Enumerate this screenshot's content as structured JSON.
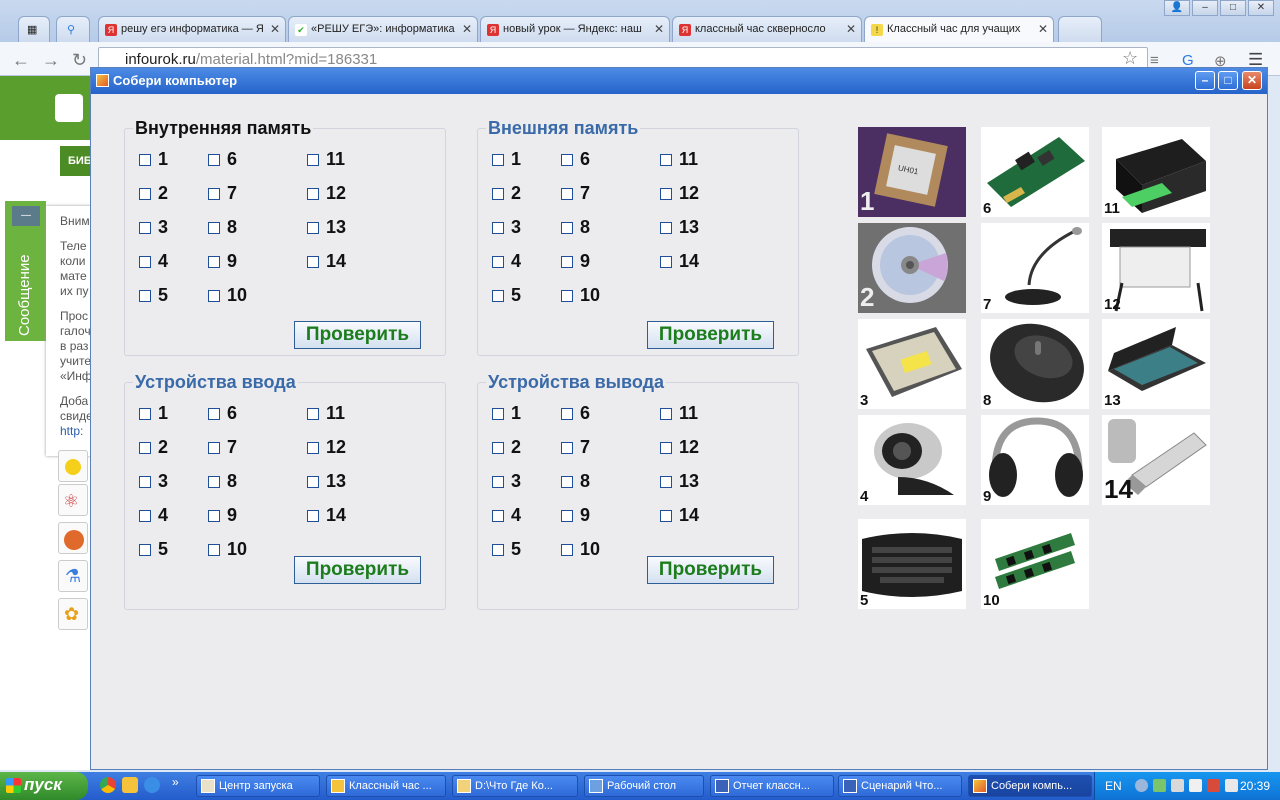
{
  "browser": {
    "tabs": [
      {
        "label": "решу егэ информатика — Я",
        "icon": "yandex-icon"
      },
      {
        "label": "«РЕШУ ЕГЭ»: информатика",
        "icon": "check-icon"
      },
      {
        "label": "новый урок — Яндекс: наш",
        "icon": "yandex-icon"
      },
      {
        "label": "классный час скверносло",
        "icon": "yandex-icon"
      },
      {
        "label": "Классный час для учащих",
        "icon": "page-icon"
      }
    ],
    "url_host": "infourok.ru",
    "url_path": "/material.html?mid=186331"
  },
  "background_page": {
    "nav_label": "БИБ",
    "message_tab": "Сообщение",
    "notice_lines": [
      "Вним",
      "",
      "Теле",
      "коли",
      "мате",
      "их пу",
      "",
      "Прос",
      "галоч",
      "в раз",
      "учите",
      "«Инф",
      "",
      "Доба",
      "свиде",
      "http:"
    ]
  },
  "app": {
    "title": "Собери компьютер",
    "check_label": "Проверить",
    "panels": [
      {
        "title": "Внутренняя память",
        "title_style": "dark",
        "numbers": [
          1,
          2,
          3,
          4,
          5,
          6,
          7,
          8,
          9,
          10,
          11,
          12,
          13,
          14
        ]
      },
      {
        "title": "Внешняя память",
        "title_style": "blue",
        "numbers": [
          1,
          2,
          3,
          4,
          5,
          6,
          7,
          8,
          9,
          10,
          11,
          12,
          13,
          14
        ]
      },
      {
        "title": "Устройства ввода",
        "title_style": "blue",
        "numbers": [
          1,
          2,
          3,
          4,
          5,
          6,
          7,
          8,
          9,
          10,
          11,
          12,
          13,
          14
        ]
      },
      {
        "title": "Устройства вывода",
        "title_style": "blue",
        "numbers": [
          1,
          2,
          3,
          4,
          5,
          6,
          7,
          8,
          9,
          10,
          11,
          12,
          13,
          14
        ]
      }
    ],
    "tiles": [
      {
        "num": "1",
        "device": "processor-chip-image"
      },
      {
        "num": "2",
        "device": "cd-disc-image"
      },
      {
        "num": "3",
        "device": "hard-drive-image"
      },
      {
        "num": "4",
        "device": "webcam-image"
      },
      {
        "num": "5",
        "device": "keyboard-image"
      },
      {
        "num": "6",
        "device": "network-card-image"
      },
      {
        "num": "7",
        "device": "microphone-image"
      },
      {
        "num": "8",
        "device": "mouse-image"
      },
      {
        "num": "9",
        "device": "headphones-image"
      },
      {
        "num": "10",
        "device": "ram-modules-image"
      },
      {
        "num": "11",
        "device": "printer-image"
      },
      {
        "num": "12",
        "device": "plotter-image"
      },
      {
        "num": "13",
        "device": "scanner-image"
      },
      {
        "num": "14",
        "device": "usb-flash-drive-image"
      }
    ]
  },
  "taskbar": {
    "start_label": "пуск",
    "tasks": [
      {
        "label": "Центр запуска"
      },
      {
        "label": "Классный час ..."
      },
      {
        "label": "D:\\Что Где Ко..."
      },
      {
        "label": "Рабочий стол"
      },
      {
        "label": "Отчет классн..."
      },
      {
        "label": "Сценарий Что..."
      },
      {
        "label": "Собери компь..."
      }
    ],
    "lang": "EN",
    "clock": "20:39"
  },
  "colors": {
    "title_blue": "#3a6aa8",
    "check_green": "#1d7d1d",
    "titlebar": "#2563c9",
    "taskbar": "#245ccc",
    "start_green": "#318a2a"
  }
}
